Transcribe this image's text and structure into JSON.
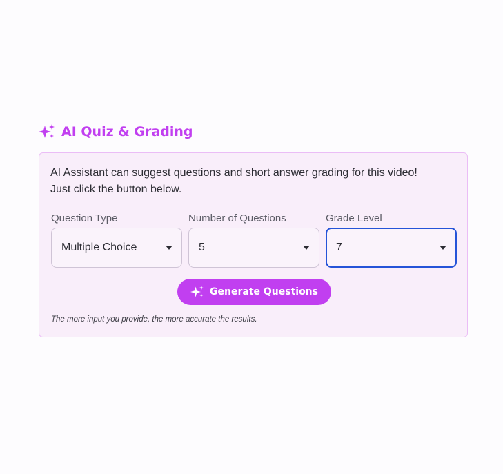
{
  "section": {
    "icon": "sparkle-icon",
    "title": "AI Quiz & Grading"
  },
  "card": {
    "description": "AI Assistant can suggest questions and short answer grading for this video! Just click the button below.",
    "fields": [
      {
        "label": "Question Type",
        "value": "Multiple Choice",
        "focused": false
      },
      {
        "label": "Number of Questions",
        "value": "5",
        "focused": false
      },
      {
        "label": "Grade Level",
        "value": "7",
        "focused": true
      }
    ],
    "generate_button": {
      "label": "Generate Questions",
      "icon": "sparkle-icon"
    },
    "note": "The more input you provide, the more accurate the results."
  },
  "colors": {
    "accent": "#c13ff0",
    "focus_border": "#2554d8",
    "card_bg": "#f9eefa",
    "card_border": "#ebbdf6"
  }
}
